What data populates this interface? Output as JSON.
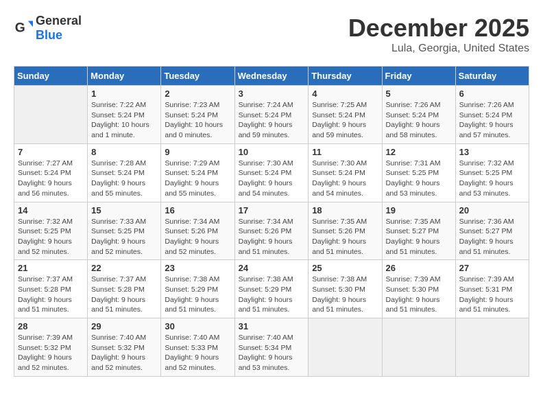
{
  "header": {
    "logo_general": "General",
    "logo_blue": "Blue",
    "month": "December 2025",
    "location": "Lula, Georgia, United States"
  },
  "days_of_week": [
    "Sunday",
    "Monday",
    "Tuesday",
    "Wednesday",
    "Thursday",
    "Friday",
    "Saturday"
  ],
  "weeks": [
    [
      {
        "day": "",
        "info": ""
      },
      {
        "day": "1",
        "info": "Sunrise: 7:22 AM\nSunset: 5:24 PM\nDaylight: 10 hours\nand 1 minute."
      },
      {
        "day": "2",
        "info": "Sunrise: 7:23 AM\nSunset: 5:24 PM\nDaylight: 10 hours\nand 0 minutes."
      },
      {
        "day": "3",
        "info": "Sunrise: 7:24 AM\nSunset: 5:24 PM\nDaylight: 9 hours\nand 59 minutes."
      },
      {
        "day": "4",
        "info": "Sunrise: 7:25 AM\nSunset: 5:24 PM\nDaylight: 9 hours\nand 59 minutes."
      },
      {
        "day": "5",
        "info": "Sunrise: 7:26 AM\nSunset: 5:24 PM\nDaylight: 9 hours\nand 58 minutes."
      },
      {
        "day": "6",
        "info": "Sunrise: 7:26 AM\nSunset: 5:24 PM\nDaylight: 9 hours\nand 57 minutes."
      }
    ],
    [
      {
        "day": "7",
        "info": "Sunrise: 7:27 AM\nSunset: 5:24 PM\nDaylight: 9 hours\nand 56 minutes."
      },
      {
        "day": "8",
        "info": "Sunrise: 7:28 AM\nSunset: 5:24 PM\nDaylight: 9 hours\nand 55 minutes."
      },
      {
        "day": "9",
        "info": "Sunrise: 7:29 AM\nSunset: 5:24 PM\nDaylight: 9 hours\nand 55 minutes."
      },
      {
        "day": "10",
        "info": "Sunrise: 7:30 AM\nSunset: 5:24 PM\nDaylight: 9 hours\nand 54 minutes."
      },
      {
        "day": "11",
        "info": "Sunrise: 7:30 AM\nSunset: 5:24 PM\nDaylight: 9 hours\nand 54 minutes."
      },
      {
        "day": "12",
        "info": "Sunrise: 7:31 AM\nSunset: 5:25 PM\nDaylight: 9 hours\nand 53 minutes."
      },
      {
        "day": "13",
        "info": "Sunrise: 7:32 AM\nSunset: 5:25 PM\nDaylight: 9 hours\nand 53 minutes."
      }
    ],
    [
      {
        "day": "14",
        "info": "Sunrise: 7:32 AM\nSunset: 5:25 PM\nDaylight: 9 hours\nand 52 minutes."
      },
      {
        "day": "15",
        "info": "Sunrise: 7:33 AM\nSunset: 5:25 PM\nDaylight: 9 hours\nand 52 minutes."
      },
      {
        "day": "16",
        "info": "Sunrise: 7:34 AM\nSunset: 5:26 PM\nDaylight: 9 hours\nand 52 minutes."
      },
      {
        "day": "17",
        "info": "Sunrise: 7:34 AM\nSunset: 5:26 PM\nDaylight: 9 hours\nand 51 minutes."
      },
      {
        "day": "18",
        "info": "Sunrise: 7:35 AM\nSunset: 5:26 PM\nDaylight: 9 hours\nand 51 minutes."
      },
      {
        "day": "19",
        "info": "Sunrise: 7:35 AM\nSunset: 5:27 PM\nDaylight: 9 hours\nand 51 minutes."
      },
      {
        "day": "20",
        "info": "Sunrise: 7:36 AM\nSunset: 5:27 PM\nDaylight: 9 hours\nand 51 minutes."
      }
    ],
    [
      {
        "day": "21",
        "info": "Sunrise: 7:37 AM\nSunset: 5:28 PM\nDaylight: 9 hours\nand 51 minutes."
      },
      {
        "day": "22",
        "info": "Sunrise: 7:37 AM\nSunset: 5:28 PM\nDaylight: 9 hours\nand 51 minutes."
      },
      {
        "day": "23",
        "info": "Sunrise: 7:38 AM\nSunset: 5:29 PM\nDaylight: 9 hours\nand 51 minutes."
      },
      {
        "day": "24",
        "info": "Sunrise: 7:38 AM\nSunset: 5:29 PM\nDaylight: 9 hours\nand 51 minutes."
      },
      {
        "day": "25",
        "info": "Sunrise: 7:38 AM\nSunset: 5:30 PM\nDaylight: 9 hours\nand 51 minutes."
      },
      {
        "day": "26",
        "info": "Sunrise: 7:39 AM\nSunset: 5:30 PM\nDaylight: 9 hours\nand 51 minutes."
      },
      {
        "day": "27",
        "info": "Sunrise: 7:39 AM\nSunset: 5:31 PM\nDaylight: 9 hours\nand 51 minutes."
      }
    ],
    [
      {
        "day": "28",
        "info": "Sunrise: 7:39 AM\nSunset: 5:32 PM\nDaylight: 9 hours\nand 52 minutes."
      },
      {
        "day": "29",
        "info": "Sunrise: 7:40 AM\nSunset: 5:32 PM\nDaylight: 9 hours\nand 52 minutes."
      },
      {
        "day": "30",
        "info": "Sunrise: 7:40 AM\nSunset: 5:33 PM\nDaylight: 9 hours\nand 52 minutes."
      },
      {
        "day": "31",
        "info": "Sunrise: 7:40 AM\nSunset: 5:34 PM\nDaylight: 9 hours\nand 53 minutes."
      },
      {
        "day": "",
        "info": ""
      },
      {
        "day": "",
        "info": ""
      },
      {
        "day": "",
        "info": ""
      }
    ]
  ]
}
